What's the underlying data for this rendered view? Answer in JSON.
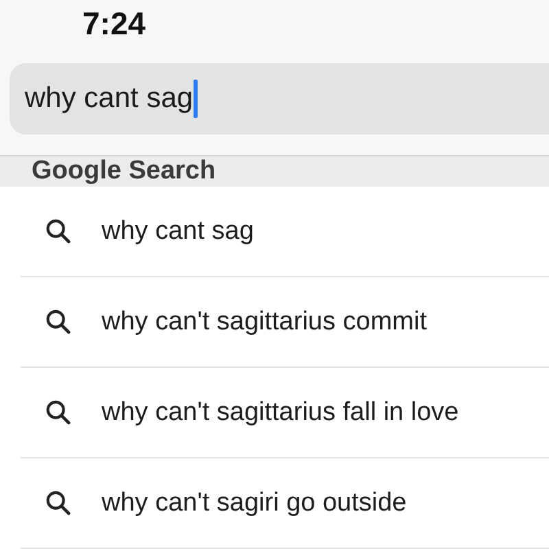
{
  "status_bar": {
    "time": "7:24"
  },
  "search": {
    "value": "why cant sag",
    "focused": true
  },
  "section": {
    "title": "Google Search"
  },
  "suggestions": [
    {
      "text": "why cant sag"
    },
    {
      "text": "why can't sagittarius commit"
    },
    {
      "text": "why can't sagittarius fall in love"
    },
    {
      "text": "why can't sagiri go outside"
    }
  ]
}
